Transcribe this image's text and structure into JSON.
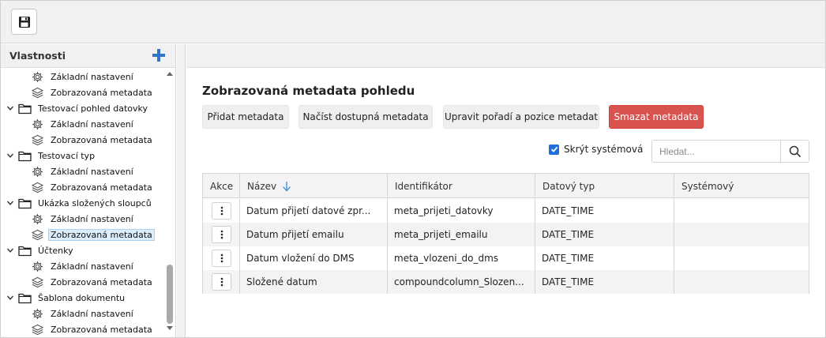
{
  "toolbar": {
    "save_icon": "save-icon"
  },
  "left_panel": {
    "title": "Vlastnosti",
    "add_icon": "plus-icon",
    "tree": [
      {
        "type": "child",
        "icon": "gear-icon",
        "label": "Základní nastavení"
      },
      {
        "type": "child",
        "icon": "layers-icon",
        "label": "Zobrazovaná metadata"
      },
      {
        "type": "folder",
        "icon": "folder-icon",
        "label": "Testovací pohled datovky"
      },
      {
        "type": "child",
        "icon": "gear-icon",
        "label": "Základní nastavení"
      },
      {
        "type": "child",
        "icon": "layers-icon",
        "label": "Zobrazovaná metadata"
      },
      {
        "type": "folder",
        "icon": "folder-icon",
        "label": "Testovací typ"
      },
      {
        "type": "child",
        "icon": "gear-icon",
        "label": "Základní nastavení"
      },
      {
        "type": "child",
        "icon": "layers-icon",
        "label": "Zobrazovaná metadata"
      },
      {
        "type": "folder",
        "icon": "folder-icon",
        "label": "Ukázka složených sloupců"
      },
      {
        "type": "child",
        "icon": "gear-icon",
        "label": "Základní nastavení"
      },
      {
        "type": "child",
        "icon": "layers-icon",
        "label": "Zobrazovaná metadata",
        "selected": true
      },
      {
        "type": "folder",
        "icon": "folder-icon",
        "label": "Účtenky"
      },
      {
        "type": "child",
        "icon": "gear-icon",
        "label": "Základní nastavení"
      },
      {
        "type": "child",
        "icon": "layers-icon",
        "label": "Zobrazovaná metadata"
      },
      {
        "type": "folder",
        "icon": "folder-icon",
        "label": "Šablona dokumentu"
      },
      {
        "type": "child",
        "icon": "gear-icon",
        "label": "Základní nastavení"
      },
      {
        "type": "child",
        "icon": "layers-icon",
        "label": "Zobrazovaná metadata"
      }
    ]
  },
  "main": {
    "title": "Zobrazovaná metadata pohledu",
    "buttons": {
      "add": "Přidat metadata",
      "load": "Načíst dostupná metadata",
      "reorder": "Upravit pořadí a pozice metadat",
      "delete": "Smazat metadata"
    },
    "hide_system": {
      "label": "Skrýt systémová",
      "checked": true
    },
    "search": {
      "placeholder": "Hledat...",
      "value": "",
      "icon": "search-icon"
    },
    "colors": {
      "danger": "#d9534f",
      "accent": "#1e6fd9"
    },
    "grid": {
      "columns": [
        "Akce",
        "Název",
        "Identifikátor",
        "Datový typ",
        "Systémový"
      ],
      "sort_icon": "arrow-down-icon",
      "rows": [
        {
          "name": "Datum přijetí datové zpr...",
          "identifier": "meta_prijeti_datovky",
          "type": "DATE_TIME",
          "system": ""
        },
        {
          "name": "Datum přijetí emailu",
          "identifier": "meta_prijeti_emailu",
          "type": "DATE_TIME",
          "system": ""
        },
        {
          "name": "Datum vložení do DMS",
          "identifier": "meta_vlozeni_do_dms",
          "type": "DATE_TIME",
          "system": ""
        },
        {
          "name": "Složené datum",
          "identifier": "compoundcolumn_Slozen...",
          "type": "DATE_TIME",
          "system": ""
        }
      ]
    }
  }
}
